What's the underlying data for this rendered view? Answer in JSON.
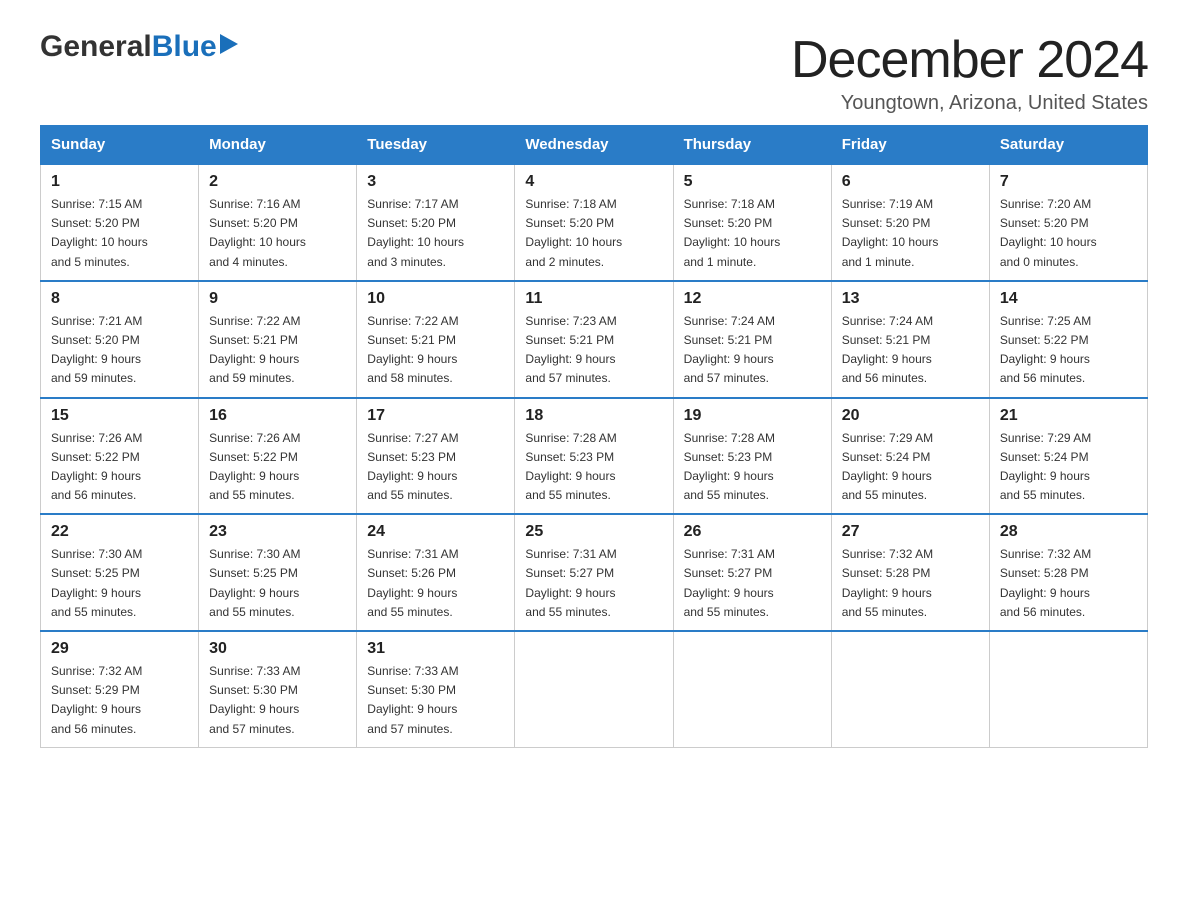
{
  "logo": {
    "text_general": "General",
    "text_blue": "Blue",
    "arrow": "▶"
  },
  "title": {
    "month_year": "December 2024",
    "location": "Youngtown, Arizona, United States"
  },
  "weekdays": [
    "Sunday",
    "Monday",
    "Tuesday",
    "Wednesday",
    "Thursday",
    "Friday",
    "Saturday"
  ],
  "weeks": [
    [
      {
        "day": "1",
        "sunrise": "7:15 AM",
        "sunset": "5:20 PM",
        "daylight": "10 hours and 5 minutes."
      },
      {
        "day": "2",
        "sunrise": "7:16 AM",
        "sunset": "5:20 PM",
        "daylight": "10 hours and 4 minutes."
      },
      {
        "day": "3",
        "sunrise": "7:17 AM",
        "sunset": "5:20 PM",
        "daylight": "10 hours and 3 minutes."
      },
      {
        "day": "4",
        "sunrise": "7:18 AM",
        "sunset": "5:20 PM",
        "daylight": "10 hours and 2 minutes."
      },
      {
        "day": "5",
        "sunrise": "7:18 AM",
        "sunset": "5:20 PM",
        "daylight": "10 hours and 1 minute."
      },
      {
        "day": "6",
        "sunrise": "7:19 AM",
        "sunset": "5:20 PM",
        "daylight": "10 hours and 1 minute."
      },
      {
        "day": "7",
        "sunrise": "7:20 AM",
        "sunset": "5:20 PM",
        "daylight": "10 hours and 0 minutes."
      }
    ],
    [
      {
        "day": "8",
        "sunrise": "7:21 AM",
        "sunset": "5:20 PM",
        "daylight": "9 hours and 59 minutes."
      },
      {
        "day": "9",
        "sunrise": "7:22 AM",
        "sunset": "5:21 PM",
        "daylight": "9 hours and 59 minutes."
      },
      {
        "day": "10",
        "sunrise": "7:22 AM",
        "sunset": "5:21 PM",
        "daylight": "9 hours and 58 minutes."
      },
      {
        "day": "11",
        "sunrise": "7:23 AM",
        "sunset": "5:21 PM",
        "daylight": "9 hours and 57 minutes."
      },
      {
        "day": "12",
        "sunrise": "7:24 AM",
        "sunset": "5:21 PM",
        "daylight": "9 hours and 57 minutes."
      },
      {
        "day": "13",
        "sunrise": "7:24 AM",
        "sunset": "5:21 PM",
        "daylight": "9 hours and 56 minutes."
      },
      {
        "day": "14",
        "sunrise": "7:25 AM",
        "sunset": "5:22 PM",
        "daylight": "9 hours and 56 minutes."
      }
    ],
    [
      {
        "day": "15",
        "sunrise": "7:26 AM",
        "sunset": "5:22 PM",
        "daylight": "9 hours and 56 minutes."
      },
      {
        "day": "16",
        "sunrise": "7:26 AM",
        "sunset": "5:22 PM",
        "daylight": "9 hours and 55 minutes."
      },
      {
        "day": "17",
        "sunrise": "7:27 AM",
        "sunset": "5:23 PM",
        "daylight": "9 hours and 55 minutes."
      },
      {
        "day": "18",
        "sunrise": "7:28 AM",
        "sunset": "5:23 PM",
        "daylight": "9 hours and 55 minutes."
      },
      {
        "day": "19",
        "sunrise": "7:28 AM",
        "sunset": "5:23 PM",
        "daylight": "9 hours and 55 minutes."
      },
      {
        "day": "20",
        "sunrise": "7:29 AM",
        "sunset": "5:24 PM",
        "daylight": "9 hours and 55 minutes."
      },
      {
        "day": "21",
        "sunrise": "7:29 AM",
        "sunset": "5:24 PM",
        "daylight": "9 hours and 55 minutes."
      }
    ],
    [
      {
        "day": "22",
        "sunrise": "7:30 AM",
        "sunset": "5:25 PM",
        "daylight": "9 hours and 55 minutes."
      },
      {
        "day": "23",
        "sunrise": "7:30 AM",
        "sunset": "5:25 PM",
        "daylight": "9 hours and 55 minutes."
      },
      {
        "day": "24",
        "sunrise": "7:31 AM",
        "sunset": "5:26 PM",
        "daylight": "9 hours and 55 minutes."
      },
      {
        "day": "25",
        "sunrise": "7:31 AM",
        "sunset": "5:27 PM",
        "daylight": "9 hours and 55 minutes."
      },
      {
        "day": "26",
        "sunrise": "7:31 AM",
        "sunset": "5:27 PM",
        "daylight": "9 hours and 55 minutes."
      },
      {
        "day": "27",
        "sunrise": "7:32 AM",
        "sunset": "5:28 PM",
        "daylight": "9 hours and 55 minutes."
      },
      {
        "day": "28",
        "sunrise": "7:32 AM",
        "sunset": "5:28 PM",
        "daylight": "9 hours and 56 minutes."
      }
    ],
    [
      {
        "day": "29",
        "sunrise": "7:32 AM",
        "sunset": "5:29 PM",
        "daylight": "9 hours and 56 minutes."
      },
      {
        "day": "30",
        "sunrise": "7:33 AM",
        "sunset": "5:30 PM",
        "daylight": "9 hours and 57 minutes."
      },
      {
        "day": "31",
        "sunrise": "7:33 AM",
        "sunset": "5:30 PM",
        "daylight": "9 hours and 57 minutes."
      },
      null,
      null,
      null,
      null
    ]
  ],
  "labels": {
    "sunrise": "Sunrise:",
    "sunset": "Sunset:",
    "daylight": "Daylight:"
  }
}
